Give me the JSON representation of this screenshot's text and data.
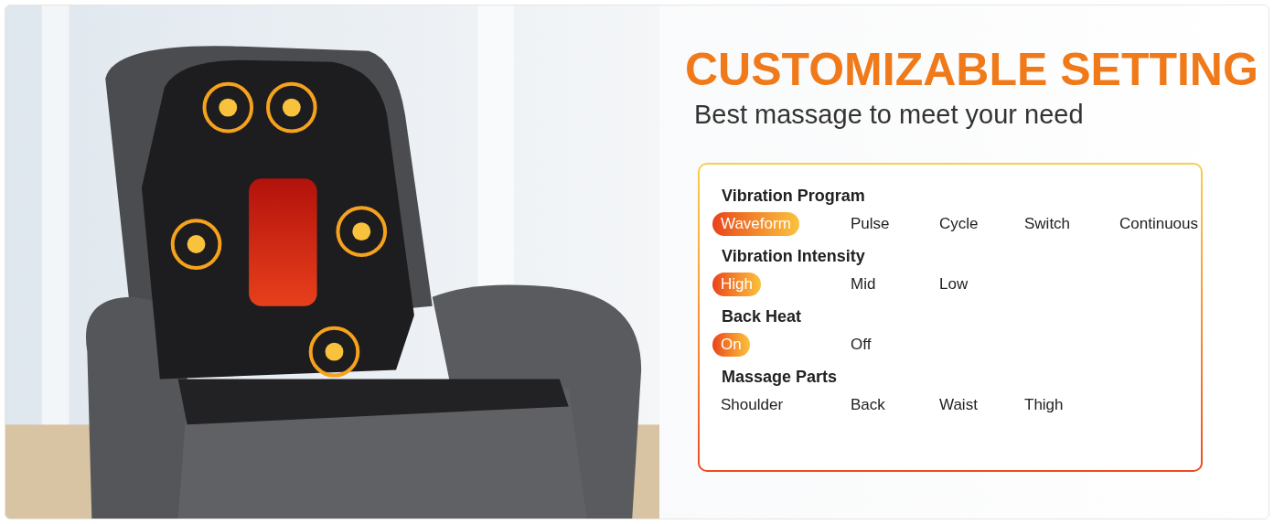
{
  "title": "CUSTOMIZABLE SETTING",
  "subtitle": "Best massage to meet your need",
  "settings": [
    {
      "label": "Vibration Program",
      "options": [
        {
          "label": "Waveform",
          "selected": true
        },
        {
          "label": "Pulse",
          "selected": false
        },
        {
          "label": "Cycle",
          "selected": false
        },
        {
          "label": "Switch",
          "selected": false
        },
        {
          "label": "Continuous",
          "selected": false
        }
      ]
    },
    {
      "label": "Vibration Intensity",
      "options": [
        {
          "label": "High",
          "selected": true
        },
        {
          "label": "Mid",
          "selected": false
        },
        {
          "label": "Low",
          "selected": false
        }
      ]
    },
    {
      "label": "Back Heat",
      "options": [
        {
          "label": "On",
          "selected": true
        },
        {
          "label": "Off",
          "selected": false
        }
      ]
    },
    {
      "label": "Massage Parts",
      "options": [
        {
          "label": "Shoulder",
          "selected": false
        },
        {
          "label": "Back",
          "selected": false
        },
        {
          "label": "Waist",
          "selected": false
        },
        {
          "label": "Thigh",
          "selected": false
        }
      ]
    }
  ]
}
